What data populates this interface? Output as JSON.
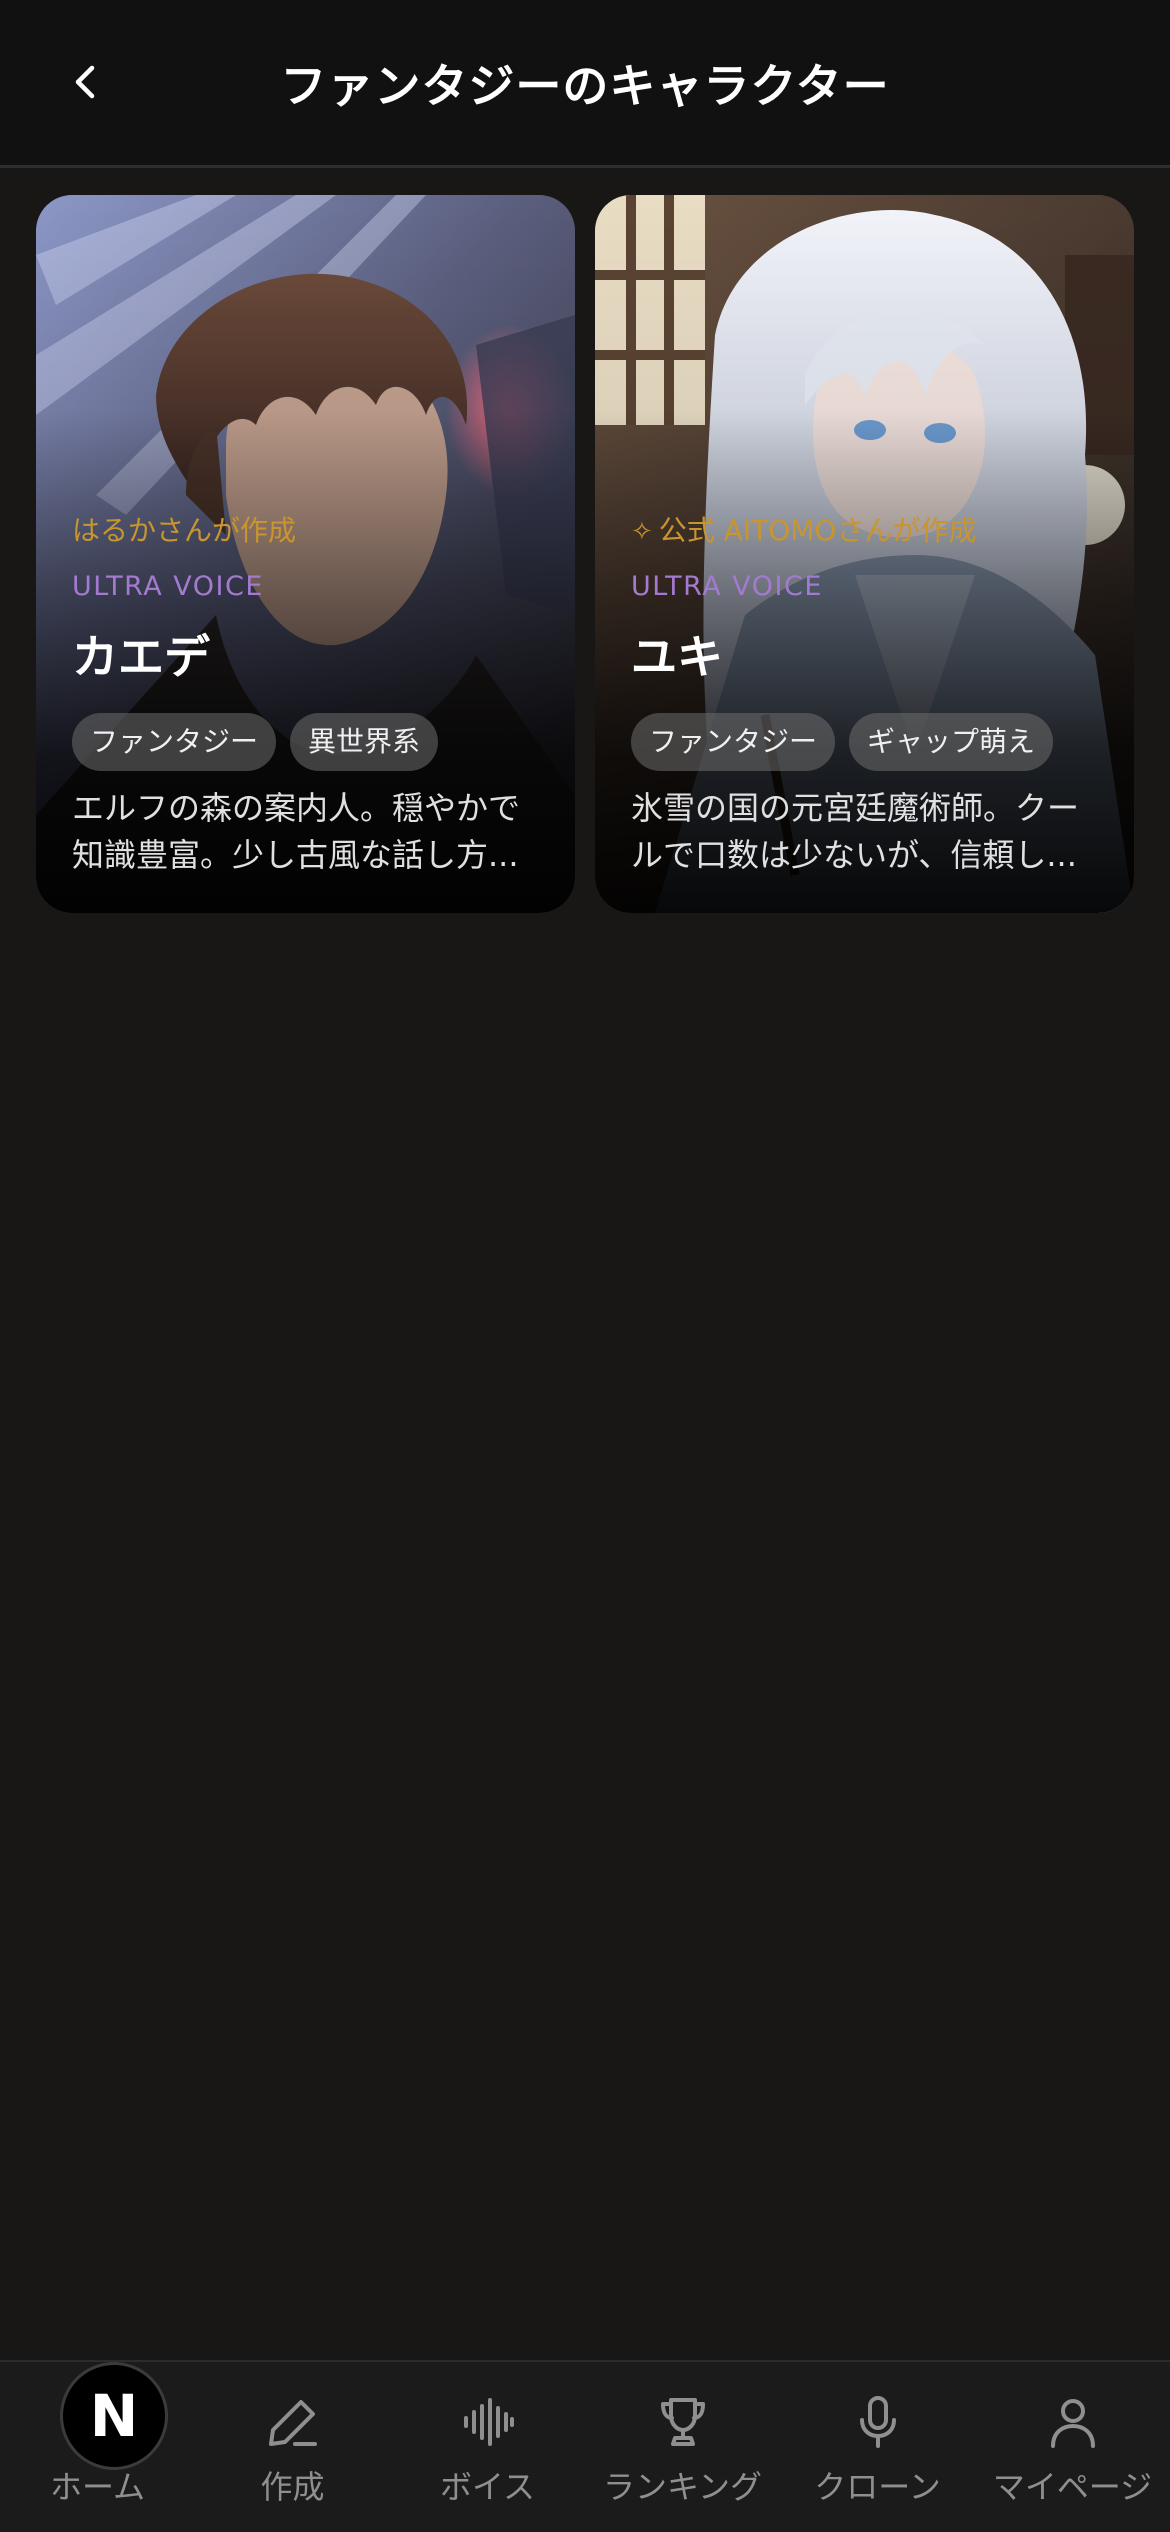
{
  "header": {
    "title": "ファンタジーのキャラクター",
    "back_icon": "chevron-left-icon"
  },
  "characters": [
    {
      "creator": "はるかさんが作成",
      "official": false,
      "voice_tier": "ULTRA VOICE",
      "name": "カエデ",
      "tags": [
        "ファンタジー",
        "異世界系"
      ],
      "description": "エルフの森の案内人。穏やかで知識豊富。少し古風な話し方..."
    },
    {
      "creator": "公式 AITOMOさんが作成",
      "official": true,
      "voice_tier": "ULTRA VOICE",
      "name": "ユキ",
      "tags": [
        "ファンタジー",
        "ギャップ萌え"
      ],
      "description": "氷雪の国の元宮廷魔術師。クールで口数は少ないが、信頼し..."
    }
  ],
  "bottom_nav": {
    "home_badge": "N",
    "items": [
      {
        "label": "ホーム",
        "icon": "home-icon"
      },
      {
        "label": "作成",
        "icon": "pencil-icon"
      },
      {
        "label": "ボイス",
        "icon": "waveform-icon"
      },
      {
        "label": "ランキング",
        "icon": "trophy-icon"
      },
      {
        "label": "クローン",
        "icon": "microphone-icon"
      },
      {
        "label": "マイページ",
        "icon": "user-icon"
      }
    ]
  },
  "colors": {
    "background": "#181716",
    "header": "#111111",
    "creator_text": "#c8952e",
    "voice_tier_text": "#a37ad0",
    "tag_bg": "#6e6e6e",
    "nav_text": "#8f8f8f"
  }
}
